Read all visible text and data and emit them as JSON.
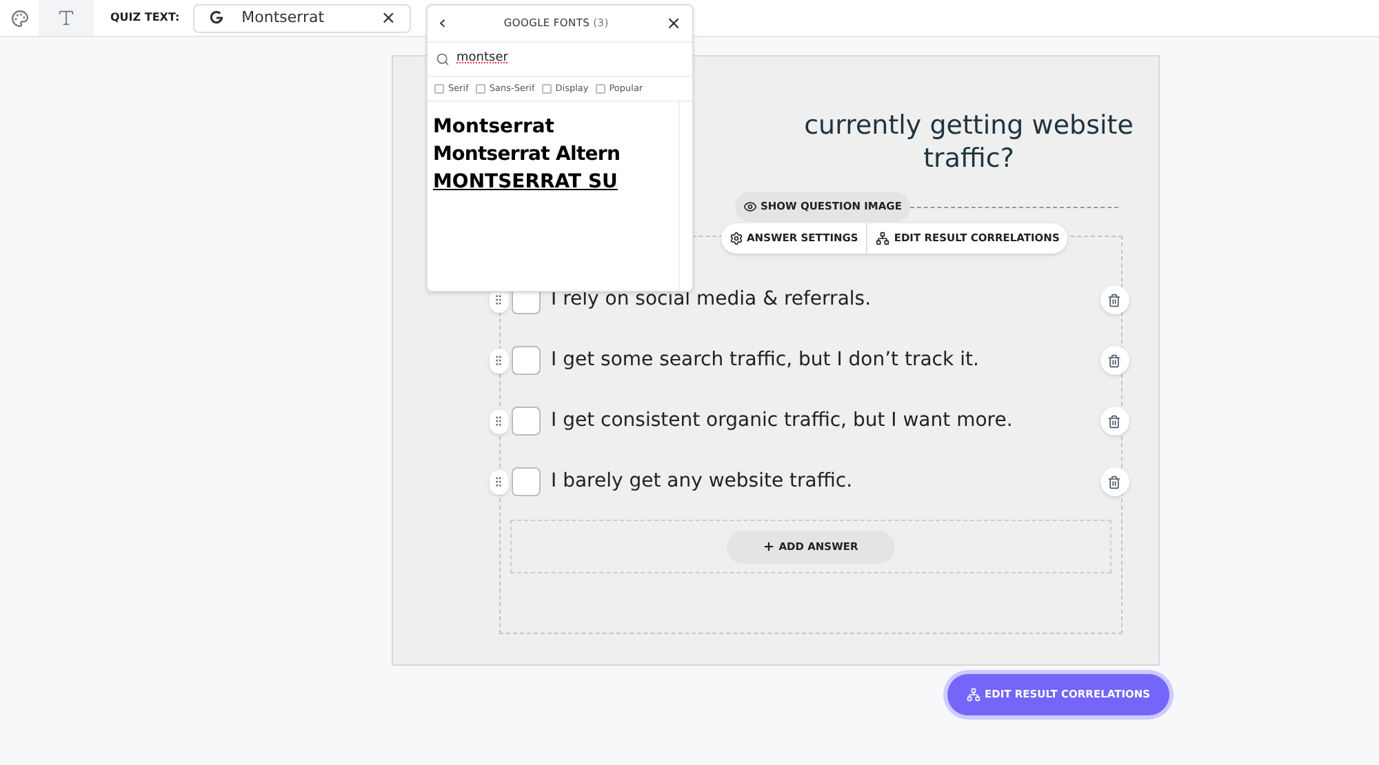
{
  "toolbar": {
    "label": "QUIZ TEXT:",
    "font_chip": {
      "value": "Montserrat",
      "clear": "×"
    }
  },
  "font_popover": {
    "back": "‹",
    "title": "GOOGLE FONTS",
    "count": "(3)",
    "close": "×",
    "search": {
      "value": "montser"
    },
    "filters": [
      {
        "label": "Serif",
        "checked": false
      },
      {
        "label": "Sans-Serif",
        "checked": false
      },
      {
        "label": "Display",
        "checked": false
      },
      {
        "label": "Popular",
        "checked": false
      }
    ],
    "results": [
      {
        "label": "Montserrat",
        "kind": "regular"
      },
      {
        "label": "Montserrat Altern",
        "kind": "alternates"
      },
      {
        "label": "MONTSERRAT SU",
        "kind": "underline"
      }
    ]
  },
  "question": {
    "title_lines": [
      "currently getting website",
      "traffic?"
    ],
    "image_button": "SHOW QUESTION IMAGE"
  },
  "answer_toolbar": [
    "ANSWER SETTINGS",
    "EDIT RESULT CORRELATIONS"
  ],
  "answers": [
    {
      "text": "I rely on social media & referrals.",
      "checked": false
    },
    {
      "text": "I get some search traffic, but I don’t track it.",
      "checked": false
    },
    {
      "text": "I get consistent organic traffic, but I want more.",
      "checked": false
    },
    {
      "text": "I barely get any website traffic.",
      "checked": false
    }
  ],
  "add_answer": "ADD ANSWER",
  "footer_button": "EDIT RESULT CORRELATIONS"
}
